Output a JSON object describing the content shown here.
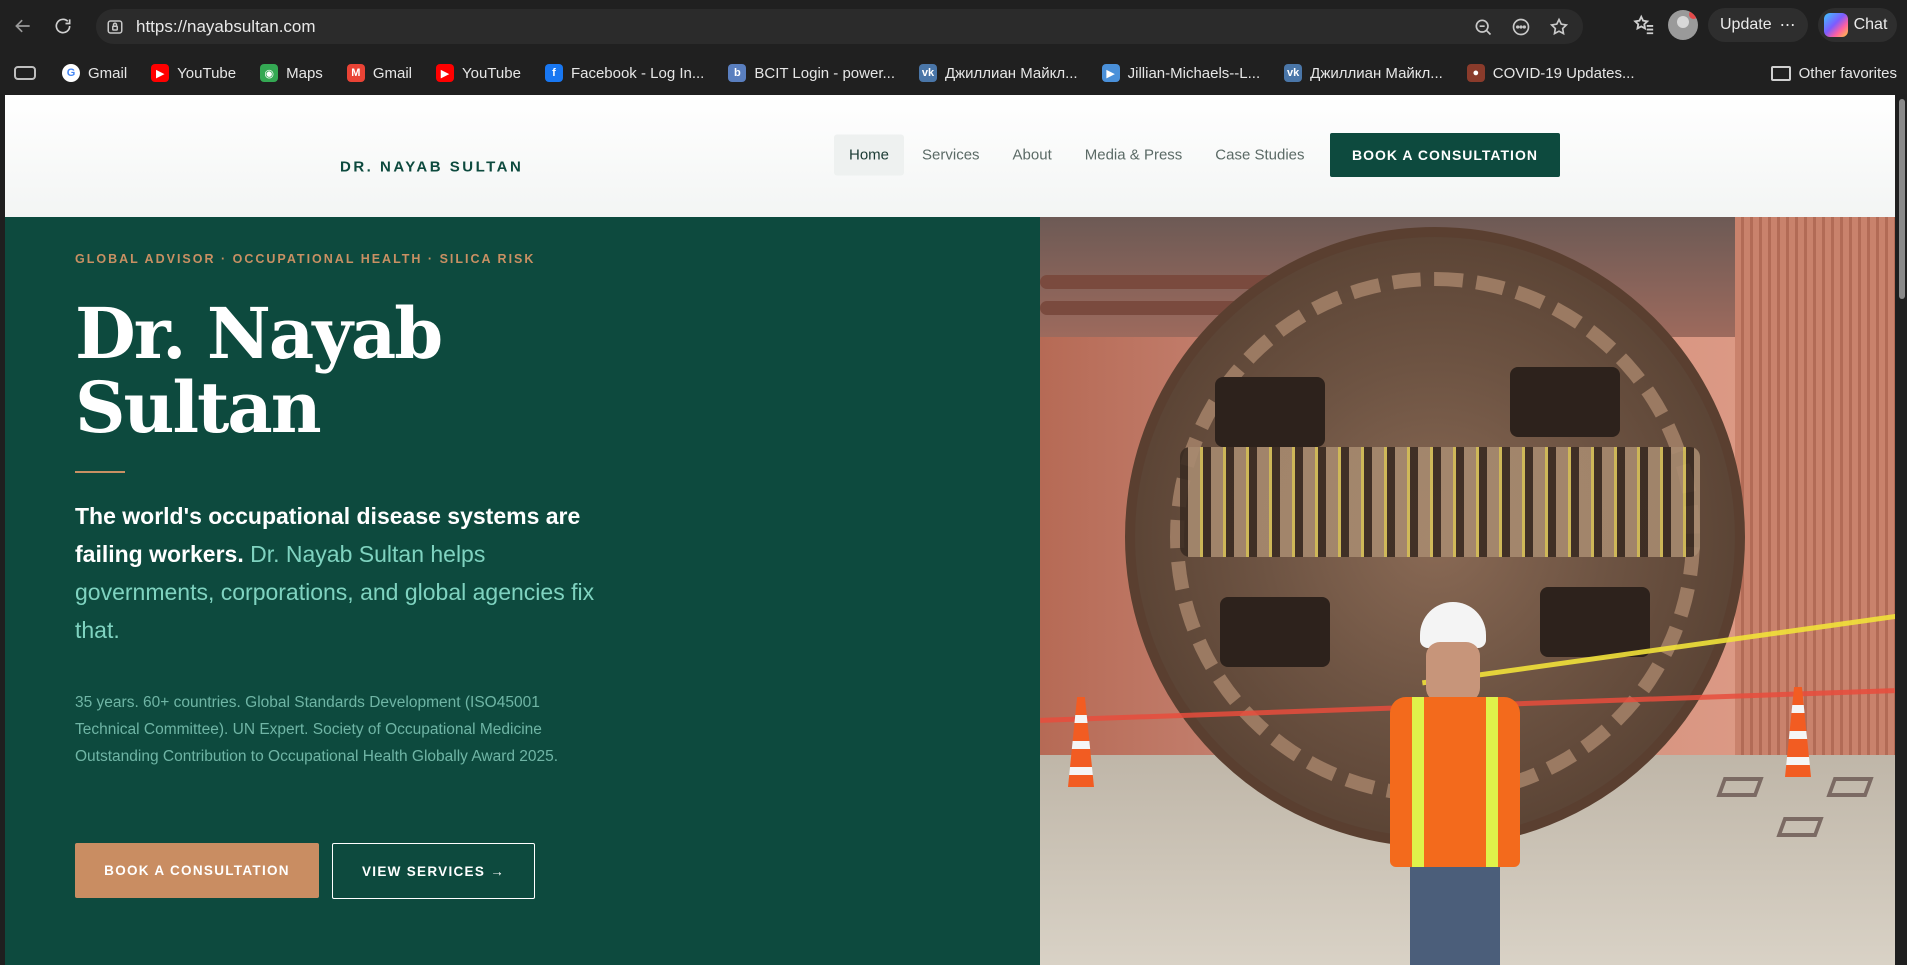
{
  "browser": {
    "url": "https://nayabsultan.com",
    "update_label": "Update",
    "chat_label": "Chat",
    "bookmarks": [
      {
        "label": "Gmail",
        "icon": "google-icon",
        "color": "#ffffff"
      },
      {
        "label": "YouTube",
        "icon": "youtube-icon",
        "color": "#ff0000"
      },
      {
        "label": "Maps",
        "icon": "maps-icon",
        "color": "#34a853"
      },
      {
        "label": "Gmail",
        "icon": "gmail-icon",
        "color": "#ea4335"
      },
      {
        "label": "YouTube",
        "icon": "youtube-icon",
        "color": "#ff0000"
      },
      {
        "label": "Facebook - Log In...",
        "icon": "facebook-icon",
        "color": "#1877f2"
      },
      {
        "label": "BCIT Login - power...",
        "icon": "bcit-icon",
        "color": "#5a7fbf"
      },
      {
        "label": "Джиллиан Майкл...",
        "icon": "vk-icon",
        "color": "#4a76a8"
      },
      {
        "label": "Jillian-Michaels--L...",
        "icon": "video-icon",
        "color": "#4a90d9"
      },
      {
        "label": "Джиллиан Майкл...",
        "icon": "vk-icon",
        "color": "#4a76a8"
      },
      {
        "label": "COVID-19 Updates...",
        "icon": "covid-icon",
        "color": "#8a3b2b"
      }
    ],
    "other_favorites": "Other favorites"
  },
  "site": {
    "brand": "DR. NAYAB SULTAN",
    "nav": [
      {
        "label": "Home",
        "active": true
      },
      {
        "label": "Services",
        "active": false
      },
      {
        "label": "About",
        "active": false
      },
      {
        "label": "Media & Press",
        "active": false
      },
      {
        "label": "Case Studies",
        "active": false
      }
    ],
    "cta": "BOOK A CONSULTATION"
  },
  "hero": {
    "eyebrow": "GLOBAL ADVISOR · OCCUPATIONAL HEALTH · SILICA RISK",
    "title_line1": "Dr. Nayab",
    "title_line2": "Sultan",
    "lede_strong": "The world's occupational disease systems are failing workers.",
    "lede_rest": " Dr. Nayab Sultan helps governments, corporations, and global agencies fix that.",
    "body": "35 years. 60+ countries. Global Standards Development (ISO45001 Technical Committee). UN Expert. Society of Occupational Medicine Outstanding Contribution to Occupational Health Globally Award 2025.",
    "primary_button": "BOOK A CONSULTATION",
    "secondary_button": "VIEW SERVICES →",
    "photo_alt": "tunnel-boring-machine-photo"
  },
  "colors": {
    "brand_green": "#0d4a3e",
    "accent_copper": "#c98d62",
    "lede_teal": "#7fd3c0"
  }
}
